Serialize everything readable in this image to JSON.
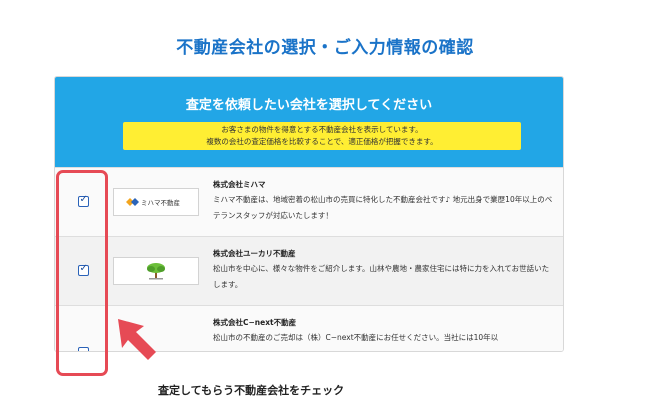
{
  "page_title": "不動産会社の選択・ご入力情報の確認",
  "panel": {
    "title": "査定を依頼したい会社を選択してください",
    "notice_lines": [
      "お客さまの物件を得意とする不動産会社を表示しています。",
      "複数の会社の査定価格を比較することで、適正価格が把握できます。"
    ]
  },
  "companies": [
    {
      "name": "株式会社ミハマ",
      "logo_text": "ミハマ不動産",
      "checked": true,
      "desc": "ミハマ不動産は、地域密着の松山市の売買に特化した不動産会社です♪ 地元出身で業歴10年以上のベテランスタッフが対応いたします！"
    },
    {
      "name": "株式会社ユーカリ不動産",
      "logo_text": "",
      "checked": true,
      "desc": "松山市を中心に、様々な物件をご紹介します。山林や農地・農家住宅には特に力を入れてお世話いたします。"
    },
    {
      "name": "株式会社C−next不動産",
      "logo_text": "",
      "checked": false,
      "desc": "松山市の不動産のご売却は（株）C−next不動産にお任せください。当社には10年以"
    }
  ],
  "caption": "査定してもらう不動産会社をチェック",
  "colors": {
    "title_blue": "#1a73c8",
    "header_blue": "#22a6e6",
    "notice_yellow": "#ffee33",
    "highlight_red": "#e64a55",
    "checkbox_blue": "#2a62b8"
  }
}
